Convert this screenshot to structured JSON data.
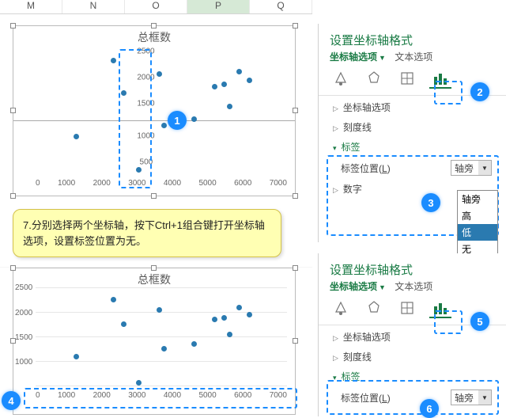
{
  "columns": [
    "M",
    "N",
    "O",
    "P",
    "Q"
  ],
  "chart": {
    "title": "总框数",
    "x_ticks": [
      "0",
      "1000",
      "2000",
      "3000",
      "4000",
      "5000",
      "6000",
      "7000"
    ],
    "y_ticks": [
      "500",
      "1000",
      "1500",
      "2000",
      "2500"
    ],
    "points_top": [
      {
        "x": 15,
        "y": 68
      },
      {
        "x": 30,
        "y": 10
      },
      {
        "x": 34,
        "y": 35
      },
      {
        "x": 40,
        "y": 94
      },
      {
        "x": 48,
        "y": 20
      },
      {
        "x": 50,
        "y": 60
      },
      {
        "x": 62,
        "y": 55
      },
      {
        "x": 70,
        "y": 30
      },
      {
        "x": 74,
        "y": 28
      },
      {
        "x": 76,
        "y": 45
      },
      {
        "x": 80,
        "y": 18
      },
      {
        "x": 84,
        "y": 25
      }
    ],
    "points_bottom": [
      {
        "x": 15,
        "y": 68
      },
      {
        "x": 30,
        "y": 10
      },
      {
        "x": 34,
        "y": 35
      },
      {
        "x": 40,
        "y": 94
      },
      {
        "x": 48,
        "y": 20
      },
      {
        "x": 50,
        "y": 60
      },
      {
        "x": 62,
        "y": 55
      },
      {
        "x": 70,
        "y": 30
      },
      {
        "x": 74,
        "y": 28
      },
      {
        "x": 76,
        "y": 45
      },
      {
        "x": 80,
        "y": 18
      },
      {
        "x": 84,
        "y": 25
      }
    ]
  },
  "instruction": "7.分别选择两个坐标轴，按下Ctrl+1组合键打开坐标轴选项，设置标签位置为无。",
  "pane": {
    "title": "设置坐标轴格式",
    "tab_axis": "坐标轴选项",
    "tab_text": "文本选项",
    "sec_axis_options": "坐标轴选项",
    "sec_ticks": "刻度线",
    "sec_labels": "标签",
    "sec_number": "数字",
    "label_position_label": "标签位置(",
    "label_position_hotkey": "L",
    "label_position_close": ")",
    "select_value": "轴旁",
    "dropdown_options": [
      "轴旁",
      "高",
      "低",
      "无"
    ]
  },
  "steps": {
    "1": "1",
    "2": "2",
    "3": "3",
    "4": "4",
    "5": "5",
    "6": "6"
  }
}
